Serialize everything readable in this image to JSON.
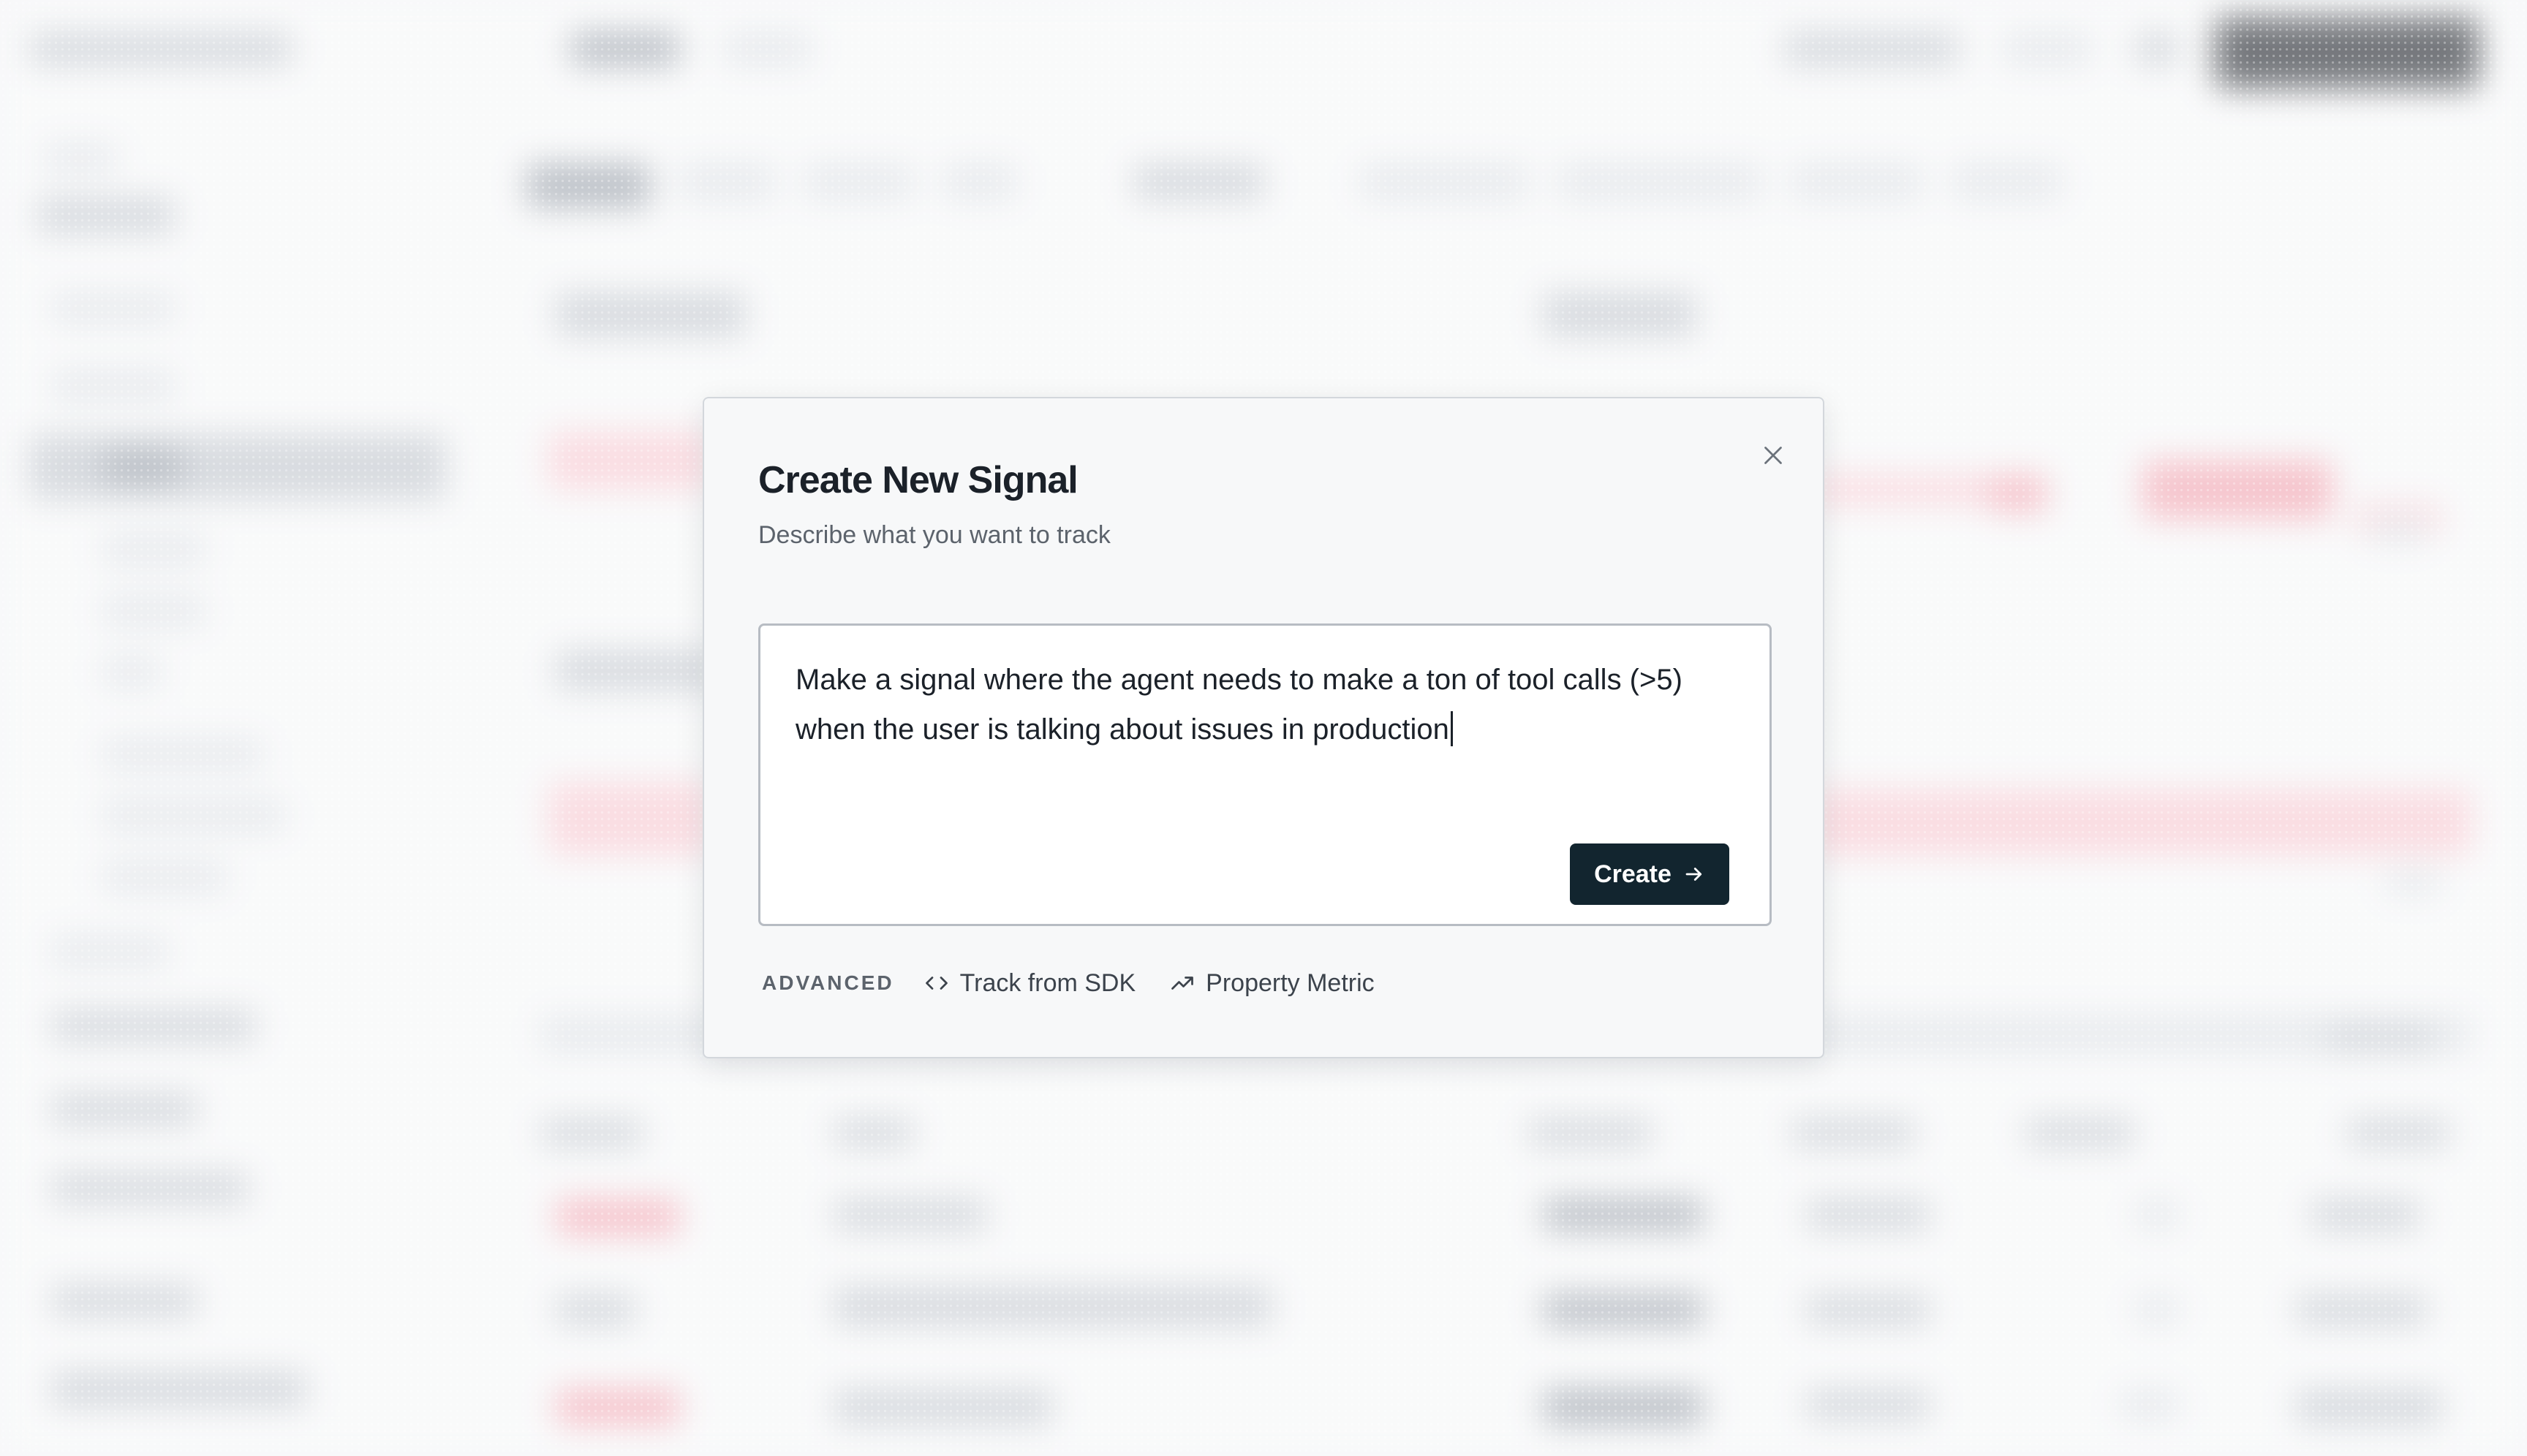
{
  "modal": {
    "title": "Create New Signal",
    "subtitle": "Describe what you want to track",
    "prompt_value": "Make a signal where the agent needs to make a ton of tool calls (>5) when the user is talking about issues in production",
    "create_label": "Create",
    "advanced": {
      "label": "ADVANCED",
      "links": [
        {
          "label": "Track from SDK",
          "icon": "code-icon"
        },
        {
          "label": "Property Metric",
          "icon": "trending-up-icon"
        }
      ]
    },
    "close_icon": "close-icon",
    "create_icon": "arrow-right-icon"
  },
  "colors": {
    "accent_button": "#12252f",
    "modal_background": "#f7f8f9",
    "text_primary": "#1b2129",
    "text_secondary": "#5c636c"
  }
}
